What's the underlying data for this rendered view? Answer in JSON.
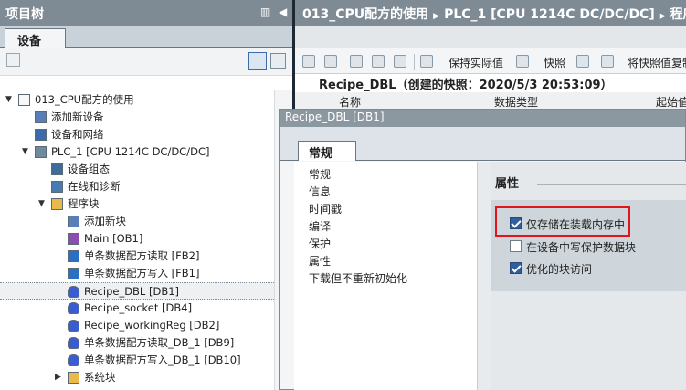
{
  "left_pane": {
    "title": "项目树",
    "tab_label": "设备",
    "tree": [
      {
        "label": "013_CPU配方的使用",
        "level": 0,
        "expander": "▼",
        "icon": "project-doc-icon"
      },
      {
        "label": "添加新设备",
        "level": 1,
        "expander": "",
        "icon": "add-device-icon"
      },
      {
        "label": "设备和网络",
        "level": 1,
        "expander": "",
        "icon": "network-icon"
      },
      {
        "label": "PLC_1 [CPU 1214C DC/DC/DC]",
        "level": 1,
        "expander": "▼",
        "icon": "plc-icon"
      },
      {
        "label": "设备组态",
        "level": 2,
        "expander": "",
        "icon": "device-config-icon"
      },
      {
        "label": "在线和诊断",
        "level": 2,
        "expander": "",
        "icon": "diagnostics-icon"
      },
      {
        "label": "程序块",
        "level": 2,
        "expander": "▼",
        "icon": "folder-icon"
      },
      {
        "label": "添加新块",
        "level": 3,
        "expander": "",
        "icon": "add-block-icon"
      },
      {
        "label": "Main [OB1]",
        "level": 3,
        "expander": "",
        "icon": "ob-block-icon"
      },
      {
        "label": "单条数据配方读取 [FB2]",
        "level": 3,
        "expander": "",
        "icon": "fb-block-icon"
      },
      {
        "label": "单条数据配方写入 [FB1]",
        "level": 3,
        "expander": "",
        "icon": "fb-block-icon"
      },
      {
        "label": "Recipe_DBL [DB1]",
        "level": 3,
        "expander": "",
        "icon": "db-block-icon",
        "selected": true
      },
      {
        "label": "Recipe_socket [DB4]",
        "level": 3,
        "expander": "",
        "icon": "db-block-icon"
      },
      {
        "label": "Recipe_workingReg [DB2]",
        "level": 3,
        "expander": "",
        "icon": "db-block-icon"
      },
      {
        "label": "单条数据配方读取_DB_1 [DB9]",
        "level": 3,
        "expander": "",
        "icon": "db-block-icon"
      },
      {
        "label": "单条数据配方写入_DB_1 [DB10]",
        "level": 3,
        "expander": "",
        "icon": "db-block-icon"
      },
      {
        "label": "系统块",
        "level": 3,
        "expander": "▶",
        "icon": "folder-icon"
      }
    ]
  },
  "right_pane": {
    "breadcrumb": [
      "013_CPU配方的使用",
      "PLC_1 [CPU 1214C DC/DC/DC]",
      "程序块"
    ],
    "toolbar": {
      "keep_actual_label": "保持实际值",
      "snapshot_label": "快照",
      "copy_snapshot_label": "将快照值复制"
    },
    "snapshot_title": "Recipe_DBL（创建的快照：2020/5/3 20:53:09）",
    "columns": [
      "名称",
      "数据类型",
      "起始值"
    ]
  },
  "dialog": {
    "title": "Recipe_DBL [DB1]",
    "tab_label": "常规",
    "nav_items": [
      "常规",
      "信息",
      "时间戳",
      "编译",
      "保护",
      "属性",
      "下载但不重新初始化"
    ],
    "section_title": "属性",
    "options": [
      {
        "label": "仅存储在装载内存中",
        "checked": true
      },
      {
        "label": "在设备中写保护数据块",
        "checked": false
      },
      {
        "label": "优化的块访问",
        "checked": true
      }
    ]
  },
  "colors": {
    "title_bar": "#7e8a94",
    "divider": "#1e2833",
    "highlight": "#e0161e",
    "checkbox_on": "#2f5f9e"
  }
}
